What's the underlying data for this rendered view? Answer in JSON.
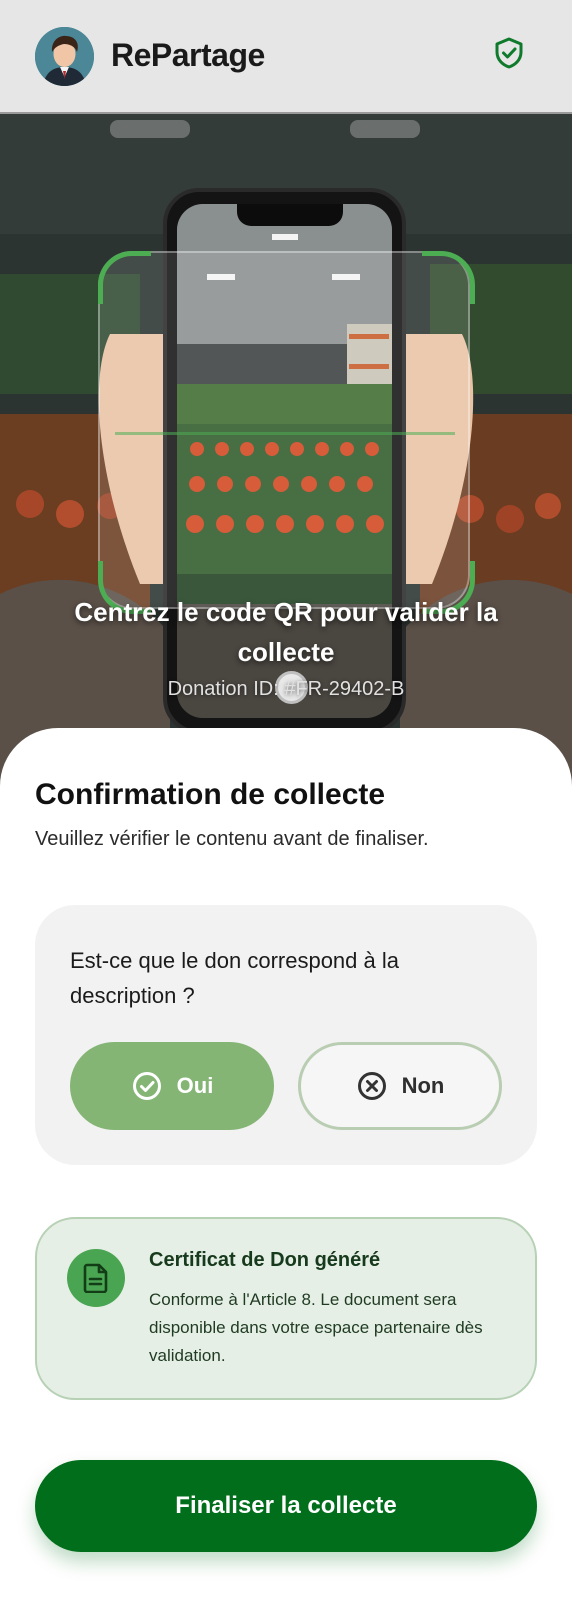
{
  "header": {
    "app_name": "RePartage",
    "avatar_icon": "user-avatar",
    "shield_icon": "shield-check-icon"
  },
  "scanner": {
    "instruction": "Centrez le code QR pour valider la collecte",
    "donation_id": "Donation ID: #FR-29402-B"
  },
  "sheet": {
    "title": "Confirmation de collecte",
    "subtitle": "Veuillez vérifier le contenu avant de finaliser.",
    "question": "Est-ce que le don correspond à la description ?",
    "yes_label": "Oui",
    "no_label": "Non",
    "certificate": {
      "title": "Certificat de Don généré",
      "text": "Conforme à l'Article 8. Le document sera disponible dans votre espace partenaire dès validation."
    },
    "finalize_label": "Finaliser la collecte"
  },
  "colors": {
    "primary": "#006e1b",
    "accent_green": "#4aa552",
    "yes_button": "#84b575",
    "header_bg": "#e6e6e6"
  }
}
